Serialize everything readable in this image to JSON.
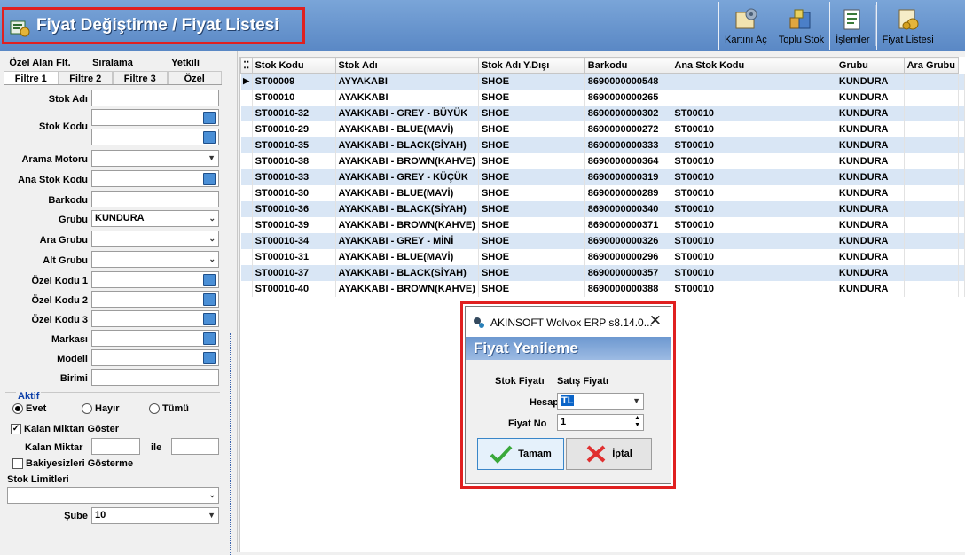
{
  "header": {
    "title": "Fiyat Değiştirme / Fiyat Listesi"
  },
  "toolbar": [
    {
      "label": "Kartını Aç",
      "icon": "open-card-icon"
    },
    {
      "label": "Toplu Stok",
      "icon": "bulk-stock-icon"
    },
    {
      "label": "İşlemler",
      "icon": "operations-icon"
    },
    {
      "label": "Fiyat Listesi",
      "icon": "price-list-icon"
    }
  ],
  "filter_tabs_top": [
    "Özel Alan Flt.",
    "Sıralama",
    "Yetkili"
  ],
  "filter_tabs": [
    "Filtre 1",
    "Filtre 2",
    "Filtre 3",
    "Özel"
  ],
  "filters": {
    "stok_adi": {
      "label": "Stok Adı",
      "value": ""
    },
    "stok_kodu": {
      "label": "Stok Kodu",
      "value1": "",
      "value2": ""
    },
    "arama_motoru": {
      "label": "Arama Motoru",
      "value": ""
    },
    "ana_stok_kodu": {
      "label": "Ana Stok Kodu",
      "value": ""
    },
    "barkodu": {
      "label": "Barkodu",
      "value": ""
    },
    "grubu": {
      "label": "Grubu",
      "value": "KUNDURA"
    },
    "ara_grubu": {
      "label": "Ara Grubu",
      "value": ""
    },
    "alt_grubu": {
      "label": "Alt Grubu",
      "value": ""
    },
    "ozel_kodu_1": {
      "label": "Özel Kodu 1",
      "value": ""
    },
    "ozel_kodu_2": {
      "label": "Özel Kodu 2",
      "value": ""
    },
    "ozel_kodu_3": {
      "label": "Özel Kodu 3",
      "value": ""
    },
    "markasi": {
      "label": "Markası",
      "value": ""
    },
    "modeli": {
      "label": "Modeli",
      "value": ""
    },
    "birimi": {
      "label": "Birimi",
      "value": ""
    },
    "aktif": {
      "label": "Aktif",
      "options": [
        "Evet",
        "Hayır",
        "Tümü"
      ],
      "selected": "Evet"
    },
    "kalan_miktari_goster": {
      "label": "Kalan Miktarı Göster",
      "checked": true
    },
    "kalan_miktar": {
      "label": "Kalan Miktar",
      "connector": "ile",
      "from": "",
      "to": ""
    },
    "bakiyesizleri_gosterme": {
      "label": "Bakiyesizleri Gösterme",
      "checked": false
    },
    "stok_limitleri": {
      "label": "Stok Limitleri",
      "value": ""
    },
    "sube": {
      "label": "Şube",
      "value": "10"
    }
  },
  "grid": {
    "columns": [
      "Stok Kodu",
      "Stok Adı",
      "Stok Adı Y.Dışı",
      "Barkodu",
      "Ana Stok Kodu",
      "Grubu",
      "Ara Grubu"
    ],
    "rows": [
      [
        "ST00009",
        "AYYAKABI",
        "SHOE",
        "8690000000548",
        "",
        "KUNDURA",
        ""
      ],
      [
        "ST00010",
        "AYAKKABI",
        "SHOE",
        "8690000000265",
        "",
        "KUNDURA",
        ""
      ],
      [
        "ST00010-32",
        "AYAKKABI - GREY - BÜYÜK",
        "SHOE",
        "8690000000302",
        "ST00010",
        "KUNDURA",
        ""
      ],
      [
        "ST00010-29",
        "AYAKKABI - BLUE(MAVİ)",
        "SHOE",
        "8690000000272",
        "ST00010",
        "KUNDURA",
        ""
      ],
      [
        "ST00010-35",
        "AYAKKABI - BLACK(SİYAH)",
        "SHOE",
        "8690000000333",
        "ST00010",
        "KUNDURA",
        ""
      ],
      [
        "ST00010-38",
        "AYAKKABI - BROWN(KAHVE)",
        "SHOE",
        "8690000000364",
        "ST00010",
        "KUNDURA",
        ""
      ],
      [
        "ST00010-33",
        "AYAKKABI - GREY - KÜÇÜK",
        "SHOE",
        "8690000000319",
        "ST00010",
        "KUNDURA",
        ""
      ],
      [
        "ST00010-30",
        "AYAKKABI - BLUE(MAVİ)",
        "SHOE",
        "8690000000289",
        "ST00010",
        "KUNDURA",
        ""
      ],
      [
        "ST00010-36",
        "AYAKKABI - BLACK(SİYAH)",
        "SHOE",
        "8690000000340",
        "ST00010",
        "KUNDURA",
        ""
      ],
      [
        "ST00010-39",
        "AYAKKABI - BROWN(KAHVE)",
        "SHOE",
        "8690000000371",
        "ST00010",
        "KUNDURA",
        ""
      ],
      [
        "ST00010-34",
        "AYAKKABI - GREY - MİNİ",
        "SHOE",
        "8690000000326",
        "ST00010",
        "KUNDURA",
        ""
      ],
      [
        "ST00010-31",
        "AYAKKABI - BLUE(MAVİ)",
        "SHOE",
        "8690000000296",
        "ST00010",
        "KUNDURA",
        ""
      ],
      [
        "ST00010-37",
        "AYAKKABI - BLACK(SİYAH)",
        "SHOE",
        "8690000000357",
        "ST00010",
        "KUNDURA",
        ""
      ],
      [
        "ST00010-40",
        "AYAKKABI - BROWN(KAHVE)",
        "SHOE",
        "8690000000388",
        "ST00010",
        "KUNDURA",
        ""
      ]
    ]
  },
  "dialog": {
    "window_title": "AKINSOFT Wolvox ERP s8.14.0...",
    "banner": "Fiyat Yenileme",
    "stok_fiyati_label": "Stok Fiyatı",
    "stok_fiyati_value": "Satış Fiyatı",
    "hesap_label": "Hesap",
    "hesap_value": "TL",
    "fiyat_no_label": "Fiyat No",
    "fiyat_no_value": "1",
    "ok_label": "Tamam",
    "cancel_label": "İptal"
  },
  "colors": {
    "header": "#5a88c5",
    "highlight": "#e02020",
    "row_alt": "#d9e6f5"
  }
}
